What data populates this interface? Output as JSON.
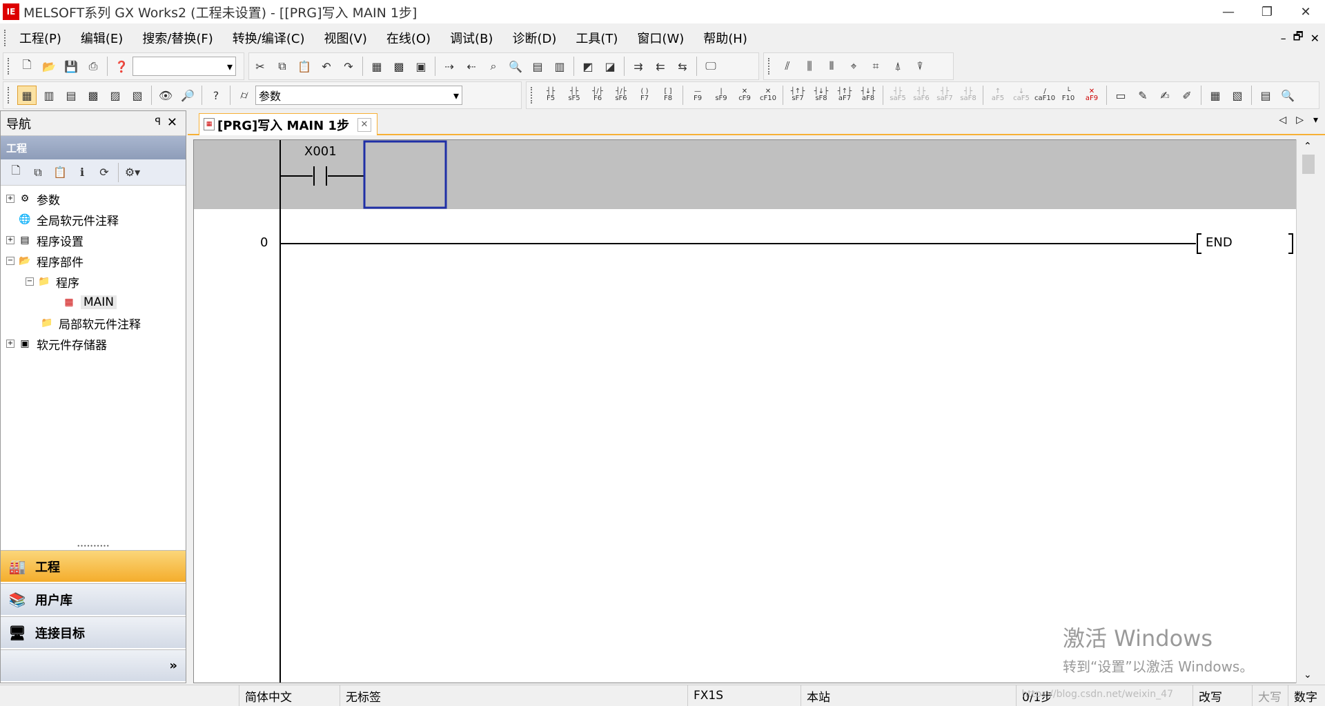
{
  "window": {
    "app_icon_text": "IE",
    "title": "MELSOFT系列 GX Works2 (工程未设置) - [[PRG]写入 MAIN 1步]",
    "minimize": "—",
    "maximize": "❐",
    "close": "✕"
  },
  "menu": {
    "items": [
      "工程(P)",
      "编辑(E)",
      "搜索/替换(F)",
      "转换/编译(C)",
      "视图(V)",
      "在线(O)",
      "调试(B)",
      "诊断(D)",
      "工具(T)",
      "窗口(W)",
      "帮助(H)"
    ],
    "mdi_min": "–",
    "mdi_restore": "🗗",
    "mdi_close": "✕"
  },
  "toolbar2": {
    "combo_value": "参数"
  },
  "ladder_keys": [
    "F5",
    "sF5",
    "F6",
    "sF6",
    "F7",
    "F8",
    "F9",
    "sF9",
    "cF9",
    "cF10",
    "sF7",
    "sF8",
    "aF7",
    "aF8",
    "saF5",
    "saF6",
    "saF7",
    "saF8",
    "aF5",
    "caF5",
    "caF10",
    "F10",
    "aF9"
  ],
  "nav": {
    "header": "导航",
    "pin": "ꟼ",
    "close": "✕",
    "section": "工程",
    "tree": [
      {
        "label": "参数",
        "expander": "+",
        "icon": "⚙"
      },
      {
        "label": "全局软元件注释",
        "expander": "",
        "icon": "🌐"
      },
      {
        "label": "程序设置",
        "expander": "+",
        "icon": "▤"
      },
      {
        "label": "程序部件",
        "expander": "−",
        "icon": "📂"
      },
      {
        "label": "程序",
        "expander": "−",
        "icon": "📁"
      },
      {
        "label": "MAIN",
        "expander": "",
        "icon": "▦"
      },
      {
        "label": "局部软元件注释",
        "expander": "",
        "icon": "📁"
      },
      {
        "label": "软元件存储器",
        "expander": "+",
        "icon": "▣"
      }
    ],
    "bottom": {
      "project": "工程",
      "library": "用户库",
      "connection": "连接目标",
      "more": "»"
    }
  },
  "editor": {
    "tab_label": "[PRG]写入 MAIN 1步",
    "tab_close": "✕",
    "contact_label": "X001",
    "rung_number": "0",
    "end_label": "END",
    "tab_nav_left": "◁",
    "tab_nav_right": "▷",
    "tab_nav_menu": "▾"
  },
  "watermark": {
    "line1": "激活 Windows",
    "line2": "转到“设置”以激活 Windows。"
  },
  "status": {
    "language": "简体中文",
    "label": "无标签",
    "plc": "FX1S",
    "station": "本站",
    "steps": "0/1步",
    "overwrite": "改写",
    "caps": "大写",
    "numlock": "数字",
    "blog": "https://blog.csdn.net/weixin_47"
  },
  "colors": {
    "accent": "#f7b035",
    "selection": "#1f2fa6",
    "edit_band": "#c0c0c0"
  }
}
